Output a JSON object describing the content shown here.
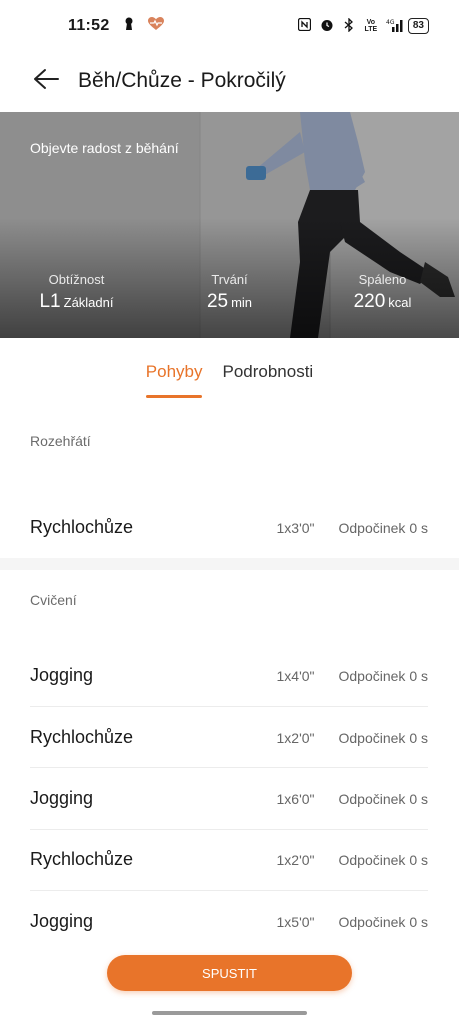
{
  "status_bar": {
    "time": "11:52",
    "battery": "83",
    "indicators": [
      "nfc-icon",
      "alarm-icon",
      "bluetooth-icon",
      "volte-icon",
      "4g-signal-icon"
    ]
  },
  "header": {
    "title": "Běh/Chůze - Pokročilý"
  },
  "hero": {
    "tagline": "Objevte radost z běhání",
    "stats": [
      {
        "label": "Obtížnost",
        "value": "L1",
        "unit": "Základní"
      },
      {
        "label": "Trvání",
        "value": "25",
        "unit": "min"
      },
      {
        "label": "Spáleno",
        "value": "220",
        "unit": "kcal"
      }
    ]
  },
  "tabs": [
    {
      "label": "Pohyby",
      "active": true
    },
    {
      "label": "Podrobnosti",
      "active": false
    }
  ],
  "sections": [
    {
      "title": "Rozehřátí",
      "items": [
        {
          "name": "Rychlochůze",
          "reps": "1x3'0\"",
          "rest": "Odpočinek 0 s"
        }
      ]
    },
    {
      "title": "Cvičení",
      "items": [
        {
          "name": "Jogging",
          "reps": "1x4'0\"",
          "rest": "Odpočinek 0 s"
        },
        {
          "name": "Rychlochůze",
          "reps": "1x2'0\"",
          "rest": "Odpočinek 0 s"
        },
        {
          "name": "Jogging",
          "reps": "1x6'0\"",
          "rest": "Odpočinek 0 s"
        },
        {
          "name": "Rychlochůze",
          "reps": "1x2'0\"",
          "rest": "Odpočinek 0 s"
        },
        {
          "name": "Jogging",
          "reps": "1x5'0\"",
          "rest": "Odpočinek 0 s"
        }
      ]
    }
  ],
  "start_button": {
    "label": "SPUSTIT"
  },
  "colors": {
    "accent": "#e8742a"
  }
}
